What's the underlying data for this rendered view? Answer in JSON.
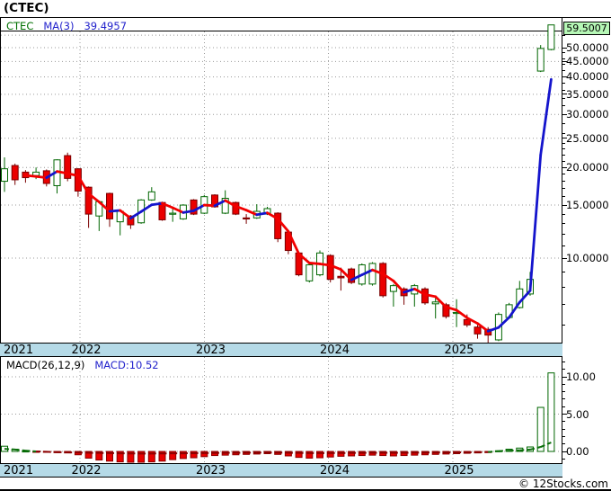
{
  "title": "(CTEC)",
  "footer": "© 12Stocks.com",
  "price_pane": {
    "legend": {
      "symbol": "CTEC",
      "ma_label": "MA(3)",
      "ma_value": "39.4957"
    },
    "last_price": "59.5007",
    "axis_labels": [
      {
        "value": 50,
        "label": "50.0000"
      },
      {
        "value": 45,
        "label": "45.0000"
      },
      {
        "value": 40,
        "label": "40.0000"
      },
      {
        "value": 35,
        "label": "35.0000"
      },
      {
        "value": 30,
        "label": "30.0000"
      },
      {
        "value": 25,
        "label": "25.0000"
      },
      {
        "value": 20,
        "label": "20.0000"
      },
      {
        "value": 15,
        "label": "15.0000"
      },
      {
        "value": 10,
        "label": "10.0000"
      }
    ]
  },
  "macd_pane": {
    "legend_left": "MACD(26,12,9)",
    "legend_right": "MACD:10.52",
    "axis_labels": [
      {
        "value": 10,
        "label": "10.00"
      },
      {
        "value": 5,
        "label": "5.00"
      },
      {
        "value": 0,
        "label": "0.00"
      }
    ]
  },
  "x_axis": {
    "years": [
      "2021",
      "2022",
      "2023",
      "2024",
      "2025"
    ]
  },
  "colors": {
    "up_border": "#006600",
    "up_fill": "#ffffff",
    "down_border": "#7a0000",
    "down_fill": "#ea0000",
    "ma_up": "#1414cc",
    "ma_down": "#f20000",
    "grid": "#999999",
    "band_bg": "#b5dae7",
    "last_price_bg": "#b6f7b6",
    "macd_pos_border": "#006600",
    "macd_neg_fill": "#ea0000",
    "macd_neg_border": "#8b0000",
    "macd_line_pos": "#0a6e0a",
    "macd_line_neg": "#8b0000"
  },
  "chart_data": {
    "type": "candlestick_with_macd",
    "symbol": "CTEC",
    "price_scale": "log",
    "price_axis_range": [
      5.6,
      62
    ],
    "ma_period": 3,
    "ohlc": [
      [
        18.0,
        21.6,
        16.6,
        19.8
      ],
      [
        20.3,
        20.6,
        17.5,
        18.2
      ],
      [
        19.3,
        19.6,
        17.8,
        18.5
      ],
      [
        18.8,
        20.0,
        18.3,
        19.3
      ],
      [
        19.5,
        19.7,
        17.3,
        17.7
      ],
      [
        17.4,
        21.3,
        16.4,
        21.2
      ],
      [
        21.9,
        22.4,
        18.0,
        18.4
      ],
      [
        19.8,
        19.9,
        16.0,
        16.7
      ],
      [
        17.2,
        17.3,
        12.6,
        14.0
      ],
      [
        13.8,
        15.5,
        12.3,
        15.4
      ],
      [
        16.4,
        16.5,
        12.7,
        13.5
      ],
      [
        13.2,
        14.4,
        11.9,
        14.3
      ],
      [
        13.8,
        13.9,
        12.5,
        12.9
      ],
      [
        13.1,
        15.7,
        13.0,
        15.6
      ],
      [
        15.6,
        17.2,
        15.5,
        16.6
      ],
      [
        15.3,
        15.4,
        13.3,
        13.4
      ],
      [
        14.0,
        14.8,
        13.2,
        14.1
      ],
      [
        13.5,
        15.1,
        13.4,
        15.0
      ],
      [
        15.6,
        15.7,
        13.9,
        14.0
      ],
      [
        14.1,
        16.2,
        14.0,
        16.0
      ],
      [
        16.2,
        16.3,
        14.7,
        14.8
      ],
      [
        14.1,
        16.8,
        14.0,
        15.8
      ],
      [
        15.3,
        15.4,
        13.9,
        14.0
      ],
      [
        13.6,
        14.0,
        13.0,
        13.5
      ],
      [
        13.6,
        15.1,
        13.5,
        14.3
      ],
      [
        14.0,
        14.8,
        13.9,
        14.6
      ],
      [
        14.1,
        14.2,
        11.3,
        11.6
      ],
      [
        12.2,
        12.3,
        10.3,
        10.6
      ],
      [
        10.4,
        10.5,
        8.7,
        8.8
      ],
      [
        8.4,
        9.6,
        8.3,
        9.5
      ],
      [
        8.8,
        10.6,
        8.7,
        10.4
      ],
      [
        10.2,
        10.3,
        8.3,
        8.5
      ],
      [
        8.7,
        9.3,
        7.8,
        8.6
      ],
      [
        9.2,
        9.3,
        8.2,
        8.3
      ],
      [
        8.2,
        9.6,
        8.1,
        9.5
      ],
      [
        8.2,
        9.7,
        8.1,
        9.6
      ],
      [
        9.6,
        9.7,
        7.4,
        7.5
      ],
      [
        7.75,
        8.2,
        6.9,
        8.1
      ],
      [
        7.9,
        8.0,
        7.0,
        7.5
      ],
      [
        7.6,
        8.2,
        6.9,
        8.1
      ],
      [
        7.9,
        8.0,
        7.0,
        7.1
      ],
      [
        7.05,
        7.5,
        6.3,
        7.15
      ],
      [
        7.0,
        7.1,
        6.3,
        6.4
      ],
      [
        6.55,
        7.3,
        5.9,
        6.6
      ],
      [
        6.25,
        6.5,
        5.9,
        6.0
      ],
      [
        5.9,
        6.0,
        5.4,
        5.6
      ],
      [
        5.8,
        5.9,
        5.1,
        5.55
      ],
      [
        5.35,
        6.6,
        5.3,
        6.5
      ],
      [
        6.35,
        7.1,
        6.3,
        7.0
      ],
      [
        6.85,
        8.4,
        6.8,
        7.9
      ],
      [
        7.6,
        9.0,
        7.5,
        8.5
      ],
      [
        41.8,
        51.0,
        41.5,
        49.7
      ],
      [
        49.3,
        59.5,
        49.0,
        59.5007
      ]
    ],
    "macd_histogram": [
      0.7,
      0.3,
      0.05,
      -0.05,
      -0.1,
      -0.15,
      -0.2,
      -0.45,
      -0.9,
      -1.15,
      -1.3,
      -1.4,
      -1.45,
      -1.45,
      -1.4,
      -1.3,
      -1.1,
      -0.95,
      -0.85,
      -0.7,
      -0.55,
      -0.5,
      -0.45,
      -0.4,
      -0.35,
      -0.3,
      -0.4,
      -0.6,
      -0.8,
      -0.9,
      -0.85,
      -0.75,
      -0.65,
      -0.6,
      -0.55,
      -0.5,
      -0.55,
      -0.6,
      -0.55,
      -0.5,
      -0.45,
      -0.4,
      -0.35,
      -0.3,
      -0.25,
      -0.2,
      -0.15,
      0.08,
      0.3,
      0.45,
      0.6,
      5.9,
      10.52
    ],
    "macd_signal_line": [
      0.35,
      0.25,
      0.1,
      0.0,
      -0.05,
      -0.1,
      -0.12,
      -0.15,
      -0.18,
      -0.2,
      -0.22,
      -0.25,
      -0.27,
      -0.28,
      -0.28,
      -0.27,
      -0.26,
      -0.25,
      -0.24,
      -0.22,
      -0.2,
      -0.19,
      -0.18,
      -0.17,
      -0.16,
      -0.15,
      -0.16,
      -0.18,
      -0.2,
      -0.22,
      -0.23,
      -0.22,
      -0.21,
      -0.2,
      -0.19,
      -0.18,
      -0.18,
      -0.19,
      -0.18,
      -0.17,
      -0.16,
      -0.15,
      -0.14,
      -0.13,
      -0.12,
      -0.1,
      -0.08,
      0.05,
      0.1,
      0.15,
      0.25,
      0.6,
      1.2
    ],
    "macd_final_value": 10.52,
    "ma_final_value": 39.4957
  }
}
